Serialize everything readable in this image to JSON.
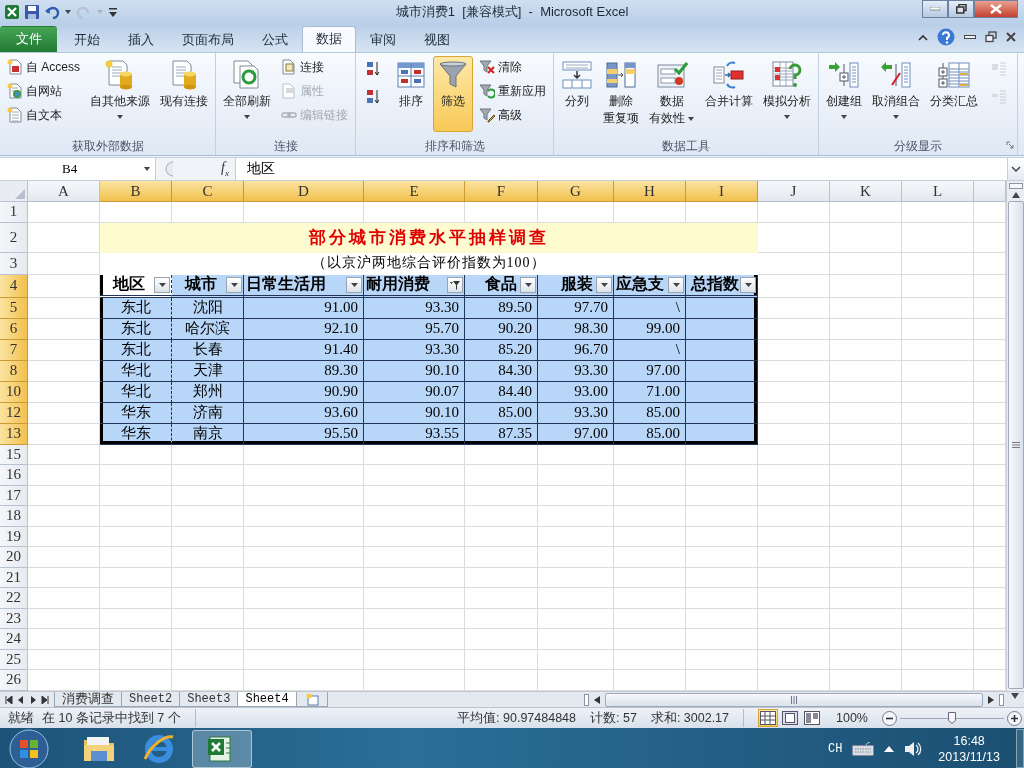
{
  "title_bar": {
    "title": "城市消费1  [兼容模式]  -  Microsoft Excel"
  },
  "ribbon_tabs": [
    {
      "label": "文件",
      "kind": "file",
      "selected": false
    },
    {
      "label": "开始",
      "kind": "tab",
      "selected": false
    },
    {
      "label": "插入",
      "kind": "tab",
      "selected": false
    },
    {
      "label": "页面布局",
      "kind": "tab",
      "selected": false
    },
    {
      "label": "公式",
      "kind": "tab",
      "selected": false
    },
    {
      "label": "数据",
      "kind": "tab",
      "selected": true
    },
    {
      "label": "审阅",
      "kind": "tab",
      "selected": false
    },
    {
      "label": "视图",
      "kind": "tab",
      "selected": false
    }
  ],
  "ribbon_groups": [
    {
      "label": "获取外部数据",
      "launcher": false,
      "items": [
        {
          "kind": "small",
          "label": "自 Access",
          "dropdown": false,
          "disabled": false,
          "selected": false
        },
        {
          "kind": "small",
          "label": "自网站",
          "dropdown": false,
          "disabled": false,
          "selected": false
        },
        {
          "kind": "small",
          "label": "自文本",
          "dropdown": false,
          "disabled": false,
          "selected": false
        },
        {
          "kind": "large",
          "lines": [
            "自其他来源"
          ],
          "dropdown": true,
          "disabled": false,
          "selected": false
        },
        {
          "kind": "large",
          "lines": [
            "现有连接"
          ],
          "dropdown": false,
          "disabled": false,
          "selected": false
        }
      ]
    },
    {
      "label": "连接",
      "launcher": false,
      "items": [
        {
          "kind": "large",
          "lines": [
            "全部刷新"
          ],
          "dropdown": true,
          "disabled": false,
          "selected": false
        },
        {
          "kind": "small",
          "label": "连接",
          "dropdown": false,
          "disabled": false,
          "selected": false
        },
        {
          "kind": "small",
          "label": "属性",
          "dropdown": false,
          "disabled": true,
          "selected": false
        },
        {
          "kind": "small",
          "label": "编辑链接",
          "dropdown": false,
          "disabled": true,
          "selected": false
        }
      ]
    },
    {
      "label": "排序和筛选",
      "launcher": false,
      "items": [
        {
          "kind": "icon",
          "dropdown": false,
          "disabled": false,
          "selected": false
        },
        {
          "kind": "icon",
          "dropdown": false,
          "disabled": false,
          "selected": false
        },
        {
          "kind": "large",
          "lines": [
            "排序"
          ],
          "dropdown": false,
          "disabled": false,
          "selected": false
        },
        {
          "kind": "large",
          "lines": [
            "筛选"
          ],
          "dropdown": false,
          "disabled": false,
          "selected": true
        },
        {
          "kind": "small",
          "label": "清除",
          "dropdown": false,
          "disabled": false,
          "selected": false
        },
        {
          "kind": "small",
          "label": "重新应用",
          "dropdown": false,
          "disabled": false,
          "selected": false
        },
        {
          "kind": "small",
          "label": "高级",
          "dropdown": false,
          "disabled": false,
          "selected": false
        }
      ]
    },
    {
      "label": "数据工具",
      "launcher": false,
      "items": [
        {
          "kind": "large",
          "lines": [
            "分列"
          ],
          "dropdown": false,
          "disabled": false,
          "selected": false
        },
        {
          "kind": "large",
          "lines": [
            "删除",
            "重复项"
          ],
          "dropdown": false,
          "disabled": false,
          "selected": false
        },
        {
          "kind": "large",
          "lines": [
            "数据",
            "有效性"
          ],
          "dropdown": true,
          "disabled": false,
          "selected": false
        },
        {
          "kind": "large",
          "lines": [
            "合并计算"
          ],
          "dropdown": false,
          "disabled": false,
          "selected": false
        },
        {
          "kind": "large",
          "lines": [
            "模拟分析"
          ],
          "dropdown": true,
          "disabled": false,
          "selected": false
        }
      ]
    },
    {
      "label": "分级显示",
      "launcher": true,
      "items": [
        {
          "kind": "large",
          "lines": [
            "创建组"
          ],
          "dropdown": true,
          "disabled": false,
          "selected": false
        },
        {
          "kind": "large",
          "lines": [
            "取消组合"
          ],
          "dropdown": true,
          "disabled": false,
          "selected": false
        },
        {
          "kind": "large",
          "lines": [
            "分类汇总"
          ],
          "dropdown": false,
          "disabled": false,
          "selected": false
        },
        {
          "kind": "icon",
          "dropdown": false,
          "disabled": true,
          "selected": false
        },
        {
          "kind": "icon",
          "dropdown": false,
          "disabled": true,
          "selected": false
        }
      ]
    }
  ],
  "formula_bar": {
    "name_box": "B4",
    "function_button": "f$_{x}$",
    "formula": "地区"
  },
  "sheet": {
    "columns": [
      {
        "label": "A",
        "selected": false
      },
      {
        "label": "B",
        "selected": true
      },
      {
        "label": "C",
        "selected": true
      },
      {
        "label": "D",
        "selected": true
      },
      {
        "label": "E",
        "selected": true
      },
      {
        "label": "F",
        "selected": true
      },
      {
        "label": "G",
        "selected": true
      },
      {
        "label": "H",
        "selected": true
      },
      {
        "label": "I",
        "selected": true
      },
      {
        "label": "J",
        "selected": false
      },
      {
        "label": "K",
        "selected": false
      },
      {
        "label": "L",
        "selected": false
      }
    ],
    "rows": [
      {
        "number": "1",
        "kind": "blank",
        "selected": false
      },
      {
        "number": "2",
        "kind": "title",
        "selected": false,
        "text": "部分城市消费水平抽样调查"
      },
      {
        "number": "3",
        "kind": "subtitle",
        "selected": false,
        "text": "（以京沪两地综合评价指数为100）"
      },
      {
        "number": "4",
        "kind": "header",
        "selected": true,
        "cells": [
          {
            "text": "地区",
            "filter_active": false,
            "active": true
          },
          {
            "text": "城市",
            "filter_active": false,
            "active": false
          },
          {
            "text": "日常生活用",
            "filter_active": false,
            "active": false
          },
          {
            "text": "耐用消费",
            "filter_active": true,
            "active": false
          },
          {
            "text": "食品",
            "filter_active": false,
            "active": false
          },
          {
            "text": "服装",
            "filter_active": false,
            "active": false
          },
          {
            "text": "应急支",
            "filter_active": false,
            "active": false
          },
          {
            "text": "总指数",
            "filter_active": false,
            "active": false
          }
        ]
      },
      {
        "number": "5",
        "kind": "data",
        "selected": true,
        "cells": [
          "东北",
          "沈阳",
          "91.00",
          "93.30",
          "89.50",
          "97.70",
          "\\"
        ]
      },
      {
        "number": "6",
        "kind": "data",
        "selected": true,
        "cells": [
          "东北",
          "哈尔滨",
          "92.10",
          "95.70",
          "90.20",
          "98.30",
          "99.00"
        ]
      },
      {
        "number": "7",
        "kind": "data",
        "selected": true,
        "cells": [
          "东北",
          "长春",
          "91.40",
          "93.30",
          "85.20",
          "96.70",
          "\\"
        ]
      },
      {
        "number": "8",
        "kind": "data",
        "selected": true,
        "cells": [
          "华北",
          "天津",
          "89.30",
          "90.10",
          "84.30",
          "93.30",
          "97.00"
        ]
      },
      {
        "number": "10",
        "kind": "data",
        "selected": true,
        "cells": [
          "华北",
          "郑州",
          "90.90",
          "90.07",
          "84.40",
          "93.00",
          "71.00"
        ]
      },
      {
        "number": "12",
        "kind": "data",
        "selected": true,
        "cells": [
          "华东",
          "济南",
          "93.60",
          "90.10",
          "85.00",
          "93.30",
          "85.00"
        ]
      },
      {
        "number": "13",
        "kind": "data",
        "selected": true,
        "cells": [
          "华东",
          "南京",
          "95.50",
          "93.55",
          "87.35",
          "97.00",
          "85.00"
        ]
      },
      {
        "number": "15",
        "kind": "blank",
        "selected": false
      },
      {
        "number": "16",
        "kind": "blank",
        "selected": false
      },
      {
        "number": "17",
        "kind": "blank",
        "selected": false
      },
      {
        "number": "18",
        "kind": "blank",
        "selected": false
      },
      {
        "number": "19",
        "kind": "blank",
        "selected": false
      },
      {
        "number": "20",
        "kind": "blank",
        "selected": false
      },
      {
        "number": "21",
        "kind": "blank",
        "selected": false
      },
      {
        "number": "22",
        "kind": "blank",
        "selected": false
      },
      {
        "number": "23",
        "kind": "blank",
        "selected": false
      },
      {
        "number": "24",
        "kind": "blank",
        "selected": false
      },
      {
        "number": "25",
        "kind": "blank",
        "selected": false
      },
      {
        "number": "26",
        "kind": "blank",
        "selected": false
      }
    ]
  },
  "sheet_tabs": [
    {
      "label": "消费调查",
      "selected": false
    },
    {
      "label": "Sheet2",
      "selected": false
    },
    {
      "label": "Sheet3",
      "selected": false
    },
    {
      "label": "Sheet4",
      "selected": true
    }
  ],
  "status_bar": {
    "mode": "就绪",
    "message": "在 10 条记录中找到 7 个",
    "average": "平均值: 90.97484848",
    "count": "计数: 57",
    "sum": "求和: 3002.17",
    "views": [
      {
        "selected": true
      },
      {
        "selected": false
      },
      {
        "selected": false
      }
    ],
    "zoom": "100%",
    "zoom_slider": {
      "level": 0.5
    }
  },
  "taskbar": {
    "apps": [
      {
        "kind": "explorer",
        "selected": false
      },
      {
        "kind": "browser",
        "selected": false
      },
      {
        "kind": "excel",
        "selected": true
      }
    ],
    "language": "CH",
    "time": "16:48",
    "date": "2013/11/13"
  }
}
